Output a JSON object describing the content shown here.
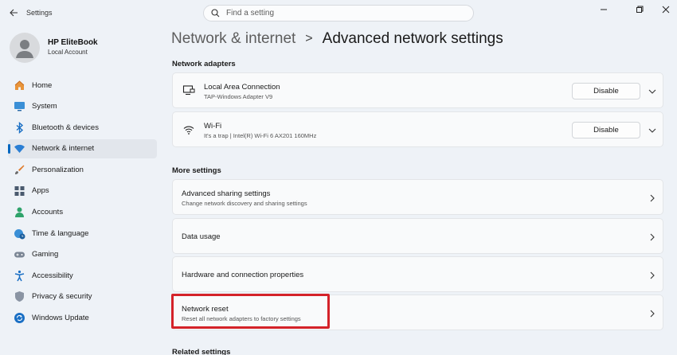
{
  "titlebar": {
    "app_title": "Settings"
  },
  "search": {
    "placeholder": "Find a setting"
  },
  "profile": {
    "name": "HP EliteBook",
    "account": "Local Account"
  },
  "nav": [
    {
      "label": "Home",
      "icon": "home-icon"
    },
    {
      "label": "System",
      "icon": "system-icon"
    },
    {
      "label": "Bluetooth & devices",
      "icon": "bluetooth-icon"
    },
    {
      "label": "Network & internet",
      "icon": "wifi-icon",
      "active": true
    },
    {
      "label": "Personalization",
      "icon": "brush-icon"
    },
    {
      "label": "Apps",
      "icon": "apps-icon"
    },
    {
      "label": "Accounts",
      "icon": "accounts-icon"
    },
    {
      "label": "Time & language",
      "icon": "globe-clock-icon"
    },
    {
      "label": "Gaming",
      "icon": "gamepad-icon"
    },
    {
      "label": "Accessibility",
      "icon": "accessibility-icon"
    },
    {
      "label": "Privacy & security",
      "icon": "shield-icon"
    },
    {
      "label": "Windows Update",
      "icon": "update-icon"
    }
  ],
  "breadcrumb": {
    "parent": "Network & internet",
    "separator": ">",
    "current": "Advanced network settings"
  },
  "adapters": {
    "title": "Network adapters",
    "items": [
      {
        "name": "Local Area Connection",
        "detail": "TAP-Windows Adapter V9",
        "button": "Disable",
        "icon": "ethernet-icon"
      },
      {
        "name": "Wi-Fi",
        "detail": "It's a trap | Intel(R) Wi-Fi 6 AX201 160MHz",
        "button": "Disable",
        "icon": "wifi-icon"
      }
    ]
  },
  "more": {
    "title": "More settings",
    "items": [
      {
        "name": "Advanced sharing settings",
        "detail": "Change network discovery and sharing settings"
      },
      {
        "name": "Data usage",
        "detail": ""
      },
      {
        "name": "Hardware and connection properties",
        "detail": ""
      },
      {
        "name": "Network reset",
        "detail": "Reset all network adapters to factory settings"
      }
    ]
  },
  "related": {
    "title": "Related settings"
  },
  "colors": {
    "accent": "#0067c0",
    "highlight": "#d42229",
    "background": "#eef2f7"
  }
}
